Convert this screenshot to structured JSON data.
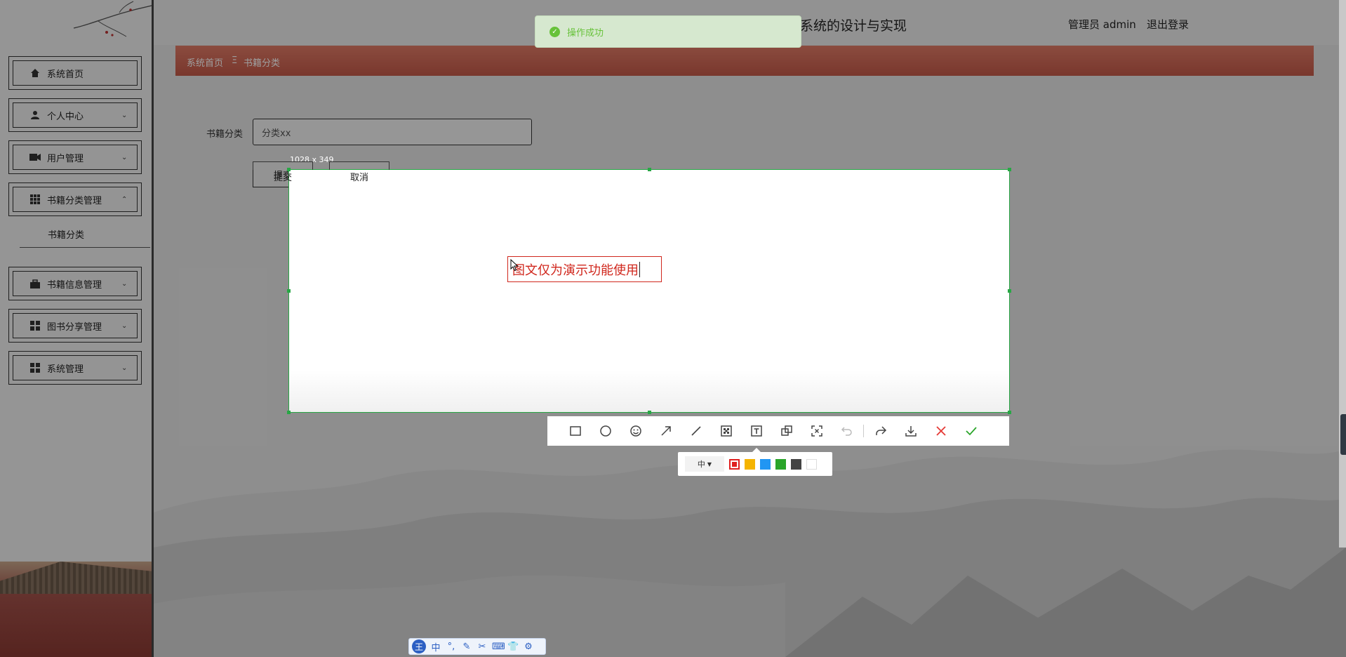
{
  "header": {
    "title": "系统的设计与实现",
    "user": "管理员 admin",
    "logout": "退出登录"
  },
  "sidebar": {
    "items": [
      {
        "label": "系统首页",
        "icon": "home-icon"
      },
      {
        "label": "个人中心",
        "icon": "user-icon"
      },
      {
        "label": "用户管理",
        "icon": "camera-icon"
      },
      {
        "label": "书籍分类管理",
        "icon": "grid-icon"
      },
      {
        "label": "书籍信息管理",
        "icon": "briefcase-icon"
      },
      {
        "label": "图书分享管理",
        "icon": "apps-icon"
      },
      {
        "label": "系统管理",
        "icon": "apps-icon"
      }
    ],
    "sub_item": "书籍分类"
  },
  "breadcrumb": {
    "home": "系统首页",
    "separator": "Ξ",
    "current": "书籍分类"
  },
  "form": {
    "label": "书籍分类",
    "value": "分类xx",
    "submit": "提交",
    "cancel": "取消"
  },
  "toast": {
    "message": "操作成功",
    "color": "#67c23a"
  },
  "screenshot": {
    "size_label": "1028 x 349",
    "text": "图文仅为演示功能使用",
    "text_color": "#d0271d",
    "border_color": "#28a745",
    "font_size_option": "中",
    "swatches": [
      "#e02020",
      "#f5b400",
      "#2196f3",
      "#2aa52a",
      "#444444",
      "#ffffff"
    ],
    "tools": [
      "rectangle-icon",
      "ellipse-icon",
      "emoji-icon",
      "arrow-icon",
      "line-icon",
      "mosaic-icon",
      "text-icon",
      "pin-icon",
      "ocr-icon",
      "undo-icon",
      "share-icon",
      "download-icon",
      "close-icon",
      "confirm-icon"
    ]
  },
  "ime": {
    "logo": "王",
    "mode": "中",
    "items": [
      "°,",
      "✎",
      "✂",
      "⌨",
      "👕",
      "⚙"
    ]
  }
}
